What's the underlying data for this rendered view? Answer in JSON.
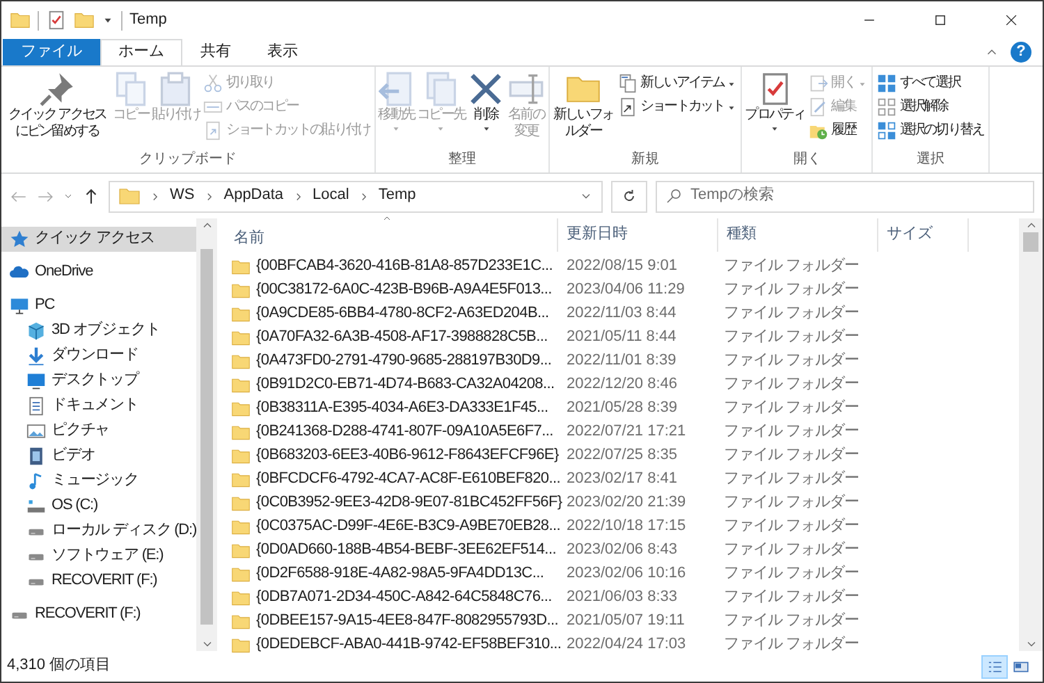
{
  "window": {
    "title": "Temp",
    "help": "?"
  },
  "ribbon_tabs": [
    {
      "label": "ファイル",
      "kind": "file",
      "selected": false
    },
    {
      "label": "ホーム",
      "kind": "tab",
      "selected": true
    },
    {
      "label": "共有",
      "kind": "tab",
      "selected": false
    },
    {
      "label": "表示",
      "kind": "tab",
      "selected": false
    }
  ],
  "ribbon_groups": [
    {
      "label": "クリップボード",
      "buttons": [
        {
          "label": "クイック アクセスにピン留めする",
          "kind": "large",
          "disabled": false,
          "dropdown": false
        },
        {
          "label": "コピー",
          "kind": "large",
          "disabled": true,
          "dropdown": false
        },
        {
          "label": "貼り付け",
          "kind": "large",
          "disabled": true,
          "dropdown": false
        },
        {
          "label": "切り取り",
          "kind": "small",
          "disabled": true,
          "dropdown": false
        },
        {
          "label": "パスのコピー",
          "kind": "small",
          "disabled": true,
          "dropdown": false
        },
        {
          "label": "ショートカットの貼り付け",
          "kind": "small",
          "disabled": true,
          "dropdown": false
        }
      ]
    },
    {
      "label": "整理",
      "buttons": [
        {
          "label": "移動先",
          "kind": "large",
          "disabled": true,
          "dropdown": true
        },
        {
          "label": "コピー先",
          "kind": "large",
          "disabled": true,
          "dropdown": true
        },
        {
          "label": "削除",
          "kind": "large",
          "disabled": false,
          "dropdown": true
        },
        {
          "label": "名前の変更",
          "kind": "large",
          "disabled": true,
          "dropdown": false
        }
      ]
    },
    {
      "label": "新規",
      "buttons": [
        {
          "label": "新しいフォルダー",
          "kind": "large",
          "disabled": false,
          "dropdown": false
        },
        {
          "label": "新しいアイテム",
          "kind": "small",
          "disabled": false,
          "dropdown": true
        },
        {
          "label": "ショートカット",
          "kind": "small",
          "disabled": false,
          "dropdown": true
        }
      ]
    },
    {
      "label": "開く",
      "buttons": [
        {
          "label": "プロパティ",
          "kind": "large",
          "disabled": false,
          "dropdown": true
        },
        {
          "label": "開く",
          "kind": "small",
          "disabled": true,
          "dropdown": true
        },
        {
          "label": "編集",
          "kind": "small",
          "disabled": true,
          "dropdown": false
        },
        {
          "label": "履歴",
          "kind": "small",
          "disabled": false,
          "dropdown": false
        }
      ]
    },
    {
      "label": "選択",
      "buttons": [
        {
          "label": "すべて選択",
          "kind": "small",
          "disabled": false,
          "dropdown": false
        },
        {
          "label": "選択解除",
          "kind": "small",
          "disabled": false,
          "dropdown": false
        },
        {
          "label": "選択の切り替え",
          "kind": "small",
          "disabled": false,
          "dropdown": false
        }
      ]
    }
  ],
  "address": {
    "crumbs": [
      "WS",
      "AppData",
      "Local",
      "Temp"
    ]
  },
  "search": {
    "placeholder": "Tempの検索"
  },
  "nav": [
    {
      "label": "クイック アクセス",
      "selected": true
    },
    {
      "label": "OneDrive",
      "selected": false
    },
    {
      "label": "PC",
      "selected": false,
      "children": [
        {
          "label": "3D オブジェクト",
          "selected": false
        },
        {
          "label": "ダウンロード",
          "selected": false
        },
        {
          "label": "デスクトップ",
          "selected": false
        },
        {
          "label": "ドキュメント",
          "selected": false
        },
        {
          "label": "ピクチャ",
          "selected": false
        },
        {
          "label": "ビデオ",
          "selected": false
        },
        {
          "label": "ミュージック",
          "selected": false
        },
        {
          "label": "OS (C:)",
          "selected": false
        },
        {
          "label": "ローカル ディスク (D:)",
          "selected": false
        },
        {
          "label": "ソフトウェア (E:)",
          "selected": false
        },
        {
          "label": "RECOVERIT (F:)",
          "selected": false
        }
      ]
    },
    {
      "label": "RECOVERIT (F:)",
      "selected": false
    }
  ],
  "table": {
    "columns": [
      {
        "label": "名前",
        "sorted": true
      },
      {
        "label": "更新日時",
        "sorted": false
      },
      {
        "label": "種類",
        "sorted": false
      },
      {
        "label": "サイズ",
        "sorted": false
      }
    ],
    "rows": [
      {
        "name": "{00BFCAB4-3620-416B-81A8-857D233E1C...",
        "date": "2022/08/15 9:01",
        "type": "ファイル フォルダー"
      },
      {
        "name": "{00C38172-6A0C-423B-B96B-A9A4E5F013...",
        "date": "2023/04/06 11:29",
        "type": "ファイル フォルダー"
      },
      {
        "name": "{0A9CDE85-6BB4-4780-8CF2-A63ED204B...",
        "date": "2022/11/03 8:44",
        "type": "ファイル フォルダー"
      },
      {
        "name": "{0A70FA32-6A3B-4508-AF17-3988828C5B...",
        "date": "2021/05/11 8:44",
        "type": "ファイル フォルダー"
      },
      {
        "name": "{0A473FD0-2791-4790-9685-288197B30D9...",
        "date": "2022/11/01 8:39",
        "type": "ファイル フォルダー"
      },
      {
        "name": "{0B91D2C0-EB71-4D74-B683-CA32A04208...",
        "date": "2022/12/20 8:46",
        "type": "ファイル フォルダー"
      },
      {
        "name": "{0B38311A-E395-4034-A6E3-DA333E1F45...",
        "date": "2021/05/28 8:39",
        "type": "ファイル フォルダー"
      },
      {
        "name": "{0B241368-D288-4741-807F-09A10A5E6F7...",
        "date": "2022/07/21 17:21",
        "type": "ファイル フォルダー"
      },
      {
        "name": "{0B683203-6EE3-40B6-9612-F8643EFCF96E}",
        "date": "2022/07/25 8:35",
        "type": "ファイル フォルダー"
      },
      {
        "name": "{0BFCDCF6-4792-4CA7-AC8F-E610BEF820...",
        "date": "2023/02/17 8:41",
        "type": "ファイル フォルダー"
      },
      {
        "name": "{0C0B3952-9EE3-42D8-9E07-81BC452FF56F}",
        "date": "2023/02/20 21:39",
        "type": "ファイル フォルダー"
      },
      {
        "name": "{0C0375AC-D99F-4E6E-B3C9-A9BE70EB28...",
        "date": "2022/10/18 17:15",
        "type": "ファイル フォルダー"
      },
      {
        "name": "{0D0AD660-188B-4B54-BEBF-3EE62EF514...",
        "date": "2023/02/06 8:43",
        "type": "ファイル フォルダー"
      },
      {
        "name": "{0D2F6588-918E-4A82-98A5-9FA4DD13C...",
        "date": "2023/02/06 10:16",
        "type": "ファイル フォルダー"
      },
      {
        "name": "{0DB7A071-2D34-450C-A842-64C5848C76...",
        "date": "2021/06/03 8:33",
        "type": "ファイル フォルダー"
      },
      {
        "name": "{0DBEE157-9A15-4EE8-847F-8082955793D...",
        "date": "2021/05/07 19:11",
        "type": "ファイル フォルダー"
      },
      {
        "name": "{0DEDEBCF-ABA0-441B-9742-EF58BEF310...",
        "date": "2022/04/24 17:03",
        "type": "ファイル フォルダー"
      }
    ]
  },
  "status_bar": {
    "count": "4,310 個の項目",
    "views": [
      {
        "selected": true
      },
      {
        "selected": false
      }
    ]
  }
}
